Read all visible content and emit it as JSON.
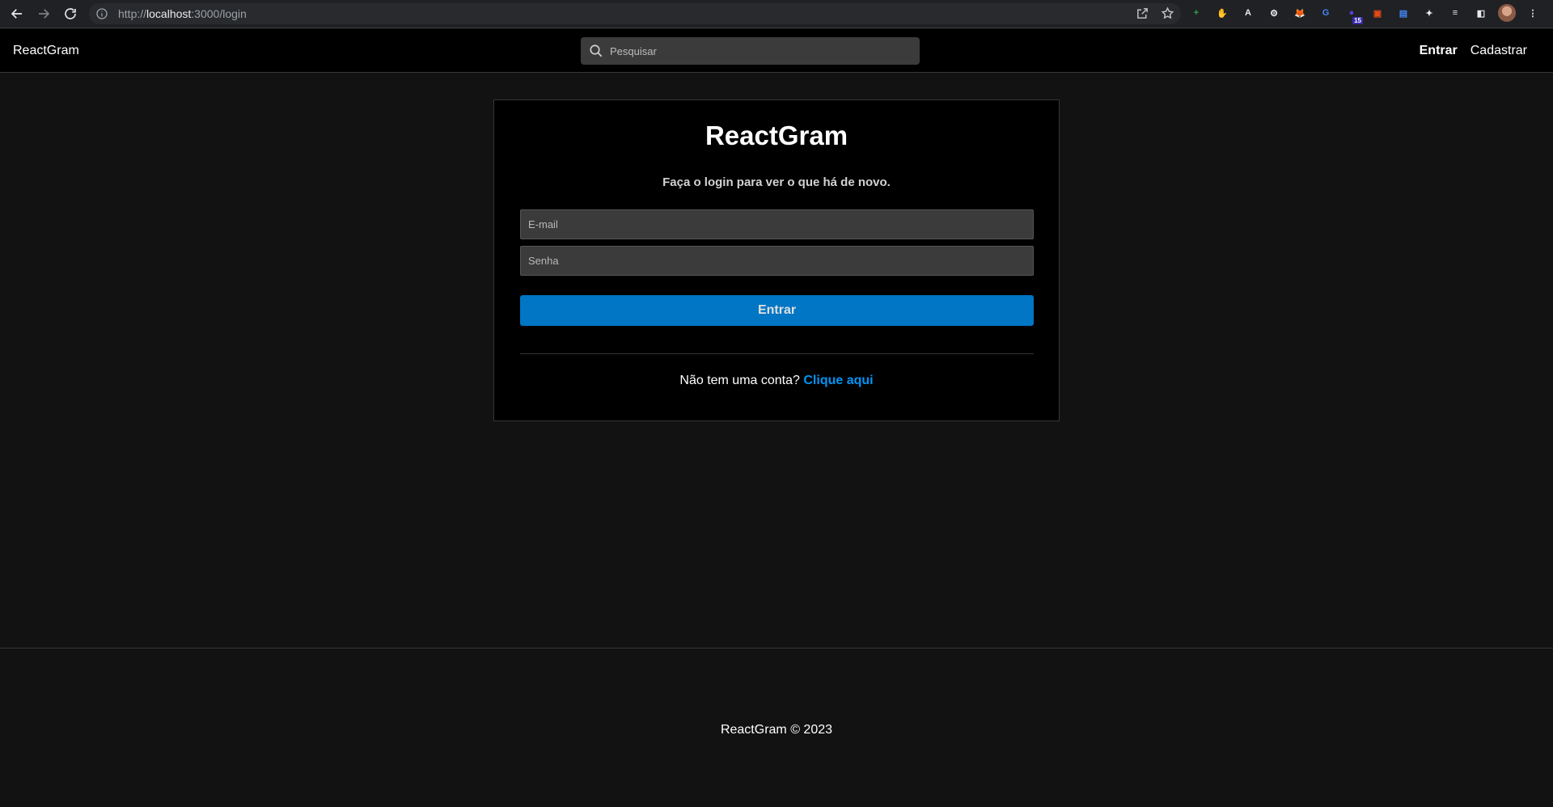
{
  "browser": {
    "url_scheme": "http://",
    "url_host": "localhost",
    "url_path": ":3000/login",
    "extensions": [
      {
        "name": "plus-circle-ext-icon",
        "color": "#2ea44f",
        "glyph": "+"
      },
      {
        "name": "red-hand-ext-icon",
        "color": "#e53935",
        "glyph": "✋"
      },
      {
        "name": "font-a-ext-icon",
        "color": "#e8eaed",
        "glyph": "A"
      },
      {
        "name": "gear-ext-icon",
        "color": "#e8eaed",
        "glyph": "⚙"
      },
      {
        "name": "fox-ext-icon",
        "color": "#f6851b",
        "glyph": "🦊"
      },
      {
        "name": "translate-ext-icon",
        "color": "#4285f4",
        "glyph": "G"
      },
      {
        "name": "badge-ext-icon",
        "color": "#5a3fd6",
        "glyph": "●",
        "badge": "15"
      },
      {
        "name": "screen-record-ext-icon",
        "color": "#e64a19",
        "glyph": "▣"
      },
      {
        "name": "docs-ext-icon",
        "color": "#4285f4",
        "glyph": "▤"
      },
      {
        "name": "puzzle-ext-icon",
        "color": "#e8eaed",
        "glyph": "✦"
      },
      {
        "name": "reading-list-icon",
        "color": "#e8eaed",
        "glyph": "≡"
      },
      {
        "name": "side-panel-icon",
        "color": "#e8eaed",
        "glyph": "◧"
      }
    ]
  },
  "navbar": {
    "brand": "ReactGram",
    "search_placeholder": "Pesquisar",
    "login_link": "Entrar",
    "register_link": "Cadastrar"
  },
  "login": {
    "title": "ReactGram",
    "subtitle": "Faça o login para ver o que há de novo.",
    "email_placeholder": "E-mail",
    "password_placeholder": "Senha",
    "submit_label": "Entrar",
    "no_account_text": "Não tem uma conta?",
    "register_link": "Clique aqui"
  },
  "footer": {
    "text": "ReactGram © 2023"
  },
  "colors": {
    "page_bg": "#121212",
    "card_bg": "#000000",
    "primary_button": "#0076c5",
    "link": "#0094f6",
    "input_bg": "#3b3b3b"
  }
}
